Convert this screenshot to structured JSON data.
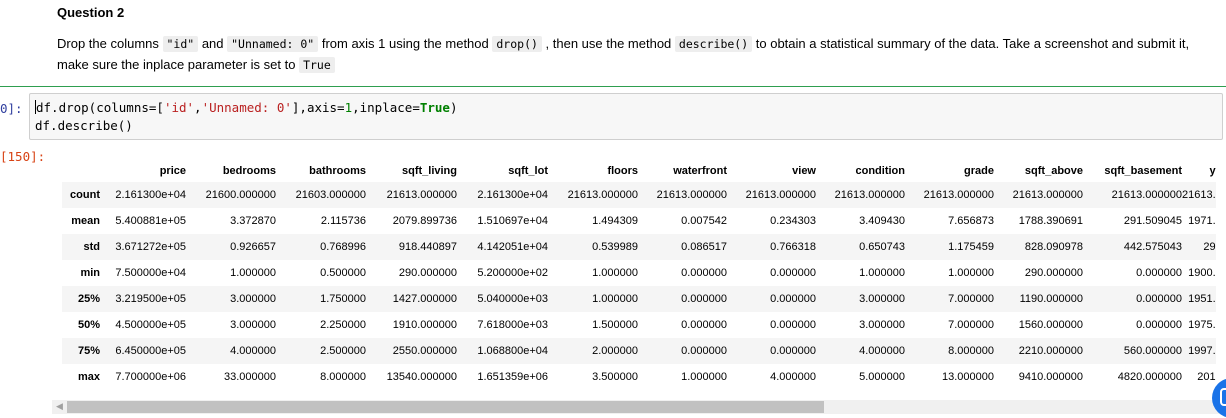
{
  "question": {
    "title": "Question 2",
    "parts": [
      {
        "t": "text",
        "v": "Drop the columns "
      },
      {
        "t": "code",
        "v": "\"id\""
      },
      {
        "t": "text",
        "v": " and "
      },
      {
        "t": "code",
        "v": "\"Unnamed: 0\""
      },
      {
        "t": "text",
        "v": " from axis 1 using the method "
      },
      {
        "t": "code",
        "v": "drop()"
      },
      {
        "t": "text",
        "v": " , then use the method "
      },
      {
        "t": "code",
        "v": "describe()"
      },
      {
        "t": "text",
        "v": " to obtain a statistical summary of the data. Take a screenshot and submit it, make sure the inplace parameter is set to "
      },
      {
        "t": "code",
        "v": "True"
      }
    ]
  },
  "input_prompt": "0]:",
  "output_prompt": "[150]:",
  "code": {
    "line1": [
      {
        "c": "",
        "v": "df.drop(columns=["
      },
      {
        "c": "k-str",
        "v": "'id'"
      },
      {
        "c": "",
        "v": ","
      },
      {
        "c": "k-str",
        "v": "'Unnamed: 0'"
      },
      {
        "c": "",
        "v": "],axis="
      },
      {
        "c": "k-num",
        "v": "1"
      },
      {
        "c": "",
        "v": ",inplace="
      },
      {
        "c": "k-kw",
        "v": "True"
      },
      {
        "c": "",
        "v": ")"
      }
    ],
    "line2": "df.describe()"
  },
  "table": {
    "columns": [
      "price",
      "bedrooms",
      "bathrooms",
      "sqft_living",
      "sqft_lot",
      "floors",
      "waterfront",
      "view",
      "condition",
      "grade",
      "sqft_above",
      "sqft_basement",
      "y"
    ],
    "rows": [
      {
        "label": "count",
        "values": [
          "2.161300e+04",
          "21600.000000",
          "21603.000000",
          "21613.000000",
          "2.161300e+04",
          "21613.000000",
          "21613.000000",
          "21613.000000",
          "21613.000000",
          "21613.000000",
          "21613.000000",
          "21613.000000",
          "21613."
        ]
      },
      {
        "label": "mean",
        "values": [
          "5.400881e+05",
          "3.372870",
          "2.115736",
          "2079.899736",
          "1.510697e+04",
          "1.494309",
          "0.007542",
          "0.234303",
          "3.409430",
          "7.656873",
          "1788.390691",
          "291.509045",
          "1971."
        ]
      },
      {
        "label": "std",
        "values": [
          "3.671272e+05",
          "0.926657",
          "0.768996",
          "918.440897",
          "4.142051e+04",
          "0.539989",
          "0.086517",
          "0.766318",
          "0.650743",
          "1.175459",
          "828.090978",
          "442.575043",
          "29"
        ]
      },
      {
        "label": "min",
        "values": [
          "7.500000e+04",
          "1.000000",
          "0.500000",
          "290.000000",
          "5.200000e+02",
          "1.000000",
          "0.000000",
          "0.000000",
          "1.000000",
          "1.000000",
          "290.000000",
          "0.000000",
          "1900."
        ]
      },
      {
        "label": "25%",
        "values": [
          "3.219500e+05",
          "3.000000",
          "1.750000",
          "1427.000000",
          "5.040000e+03",
          "1.000000",
          "0.000000",
          "0.000000",
          "3.000000",
          "7.000000",
          "1190.000000",
          "0.000000",
          "1951."
        ]
      },
      {
        "label": "50%",
        "values": [
          "4.500000e+05",
          "3.000000",
          "2.250000",
          "1910.000000",
          "7.618000e+03",
          "1.500000",
          "0.000000",
          "0.000000",
          "3.000000",
          "7.000000",
          "1560.000000",
          "0.000000",
          "1975."
        ]
      },
      {
        "label": "75%",
        "values": [
          "6.450000e+05",
          "4.000000",
          "2.500000",
          "2550.000000",
          "1.068800e+04",
          "2.000000",
          "0.000000",
          "0.000000",
          "4.000000",
          "8.000000",
          "2210.000000",
          "560.000000",
          "1997."
        ]
      },
      {
        "label": "max",
        "values": [
          "7.700000e+06",
          "33.000000",
          "8.000000",
          "13540.000000",
          "1.651359e+06",
          "3.500000",
          "1.000000",
          "4.000000",
          "5.000000",
          "13.000000",
          "9410.000000",
          "4820.000000",
          "201"
        ]
      }
    ]
  },
  "icons": {
    "scroll_left": "chevron-left-icon",
    "fab": "assistant-fab-icon"
  },
  "colors": {
    "separator": "#2e9e4f",
    "in_prompt": "#303f9f",
    "out_prompt": "#d84315",
    "fab": "#1a73e8"
  }
}
